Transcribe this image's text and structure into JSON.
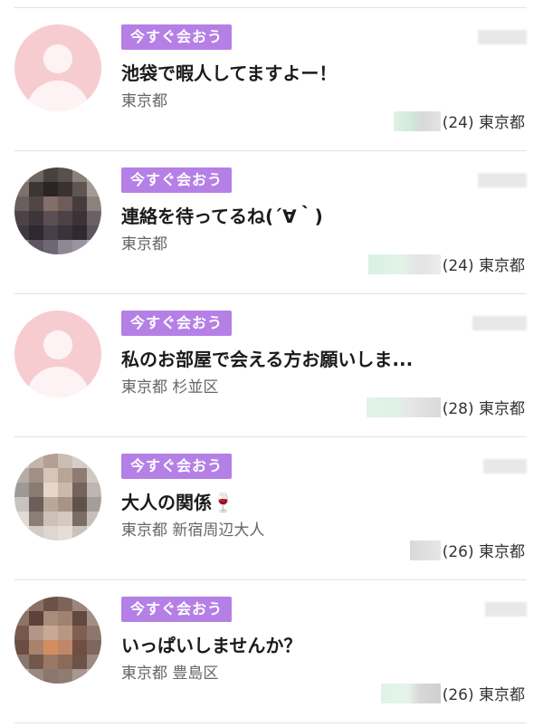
{
  "items": [
    {
      "badge": "今すぐ会おう",
      "title": "池袋で暇人してますよー！",
      "area": "東京都",
      "meta": "(24) 東京都",
      "avatar_type": "default"
    },
    {
      "badge": "今すぐ会おう",
      "title": "連絡を待ってるね(´∀｀)",
      "area": "東京都",
      "meta": "(24) 東京都",
      "avatar_type": "photo"
    },
    {
      "badge": "今すぐ会おう",
      "title": "私のお部屋で会える方お願いしま...",
      "area": "東京都 杉並区",
      "meta": "(28) 東京都",
      "avatar_type": "default"
    },
    {
      "badge": "今すぐ会おう",
      "title": "大人の関係🍷",
      "area": "東京都 新宿周辺大人",
      "meta": "(26) 東京都",
      "avatar_type": "photo"
    },
    {
      "badge": "今すぐ会おう",
      "title": "いっぱいしませんか？",
      "area": "東京都 豊島区",
      "meta": "(26) 東京都",
      "avatar_type": "photo"
    }
  ],
  "colors": {
    "badge_bg": "#b580e6",
    "default_avatar_bg": "#f7ccd0",
    "divider": "#e2e2e2"
  }
}
